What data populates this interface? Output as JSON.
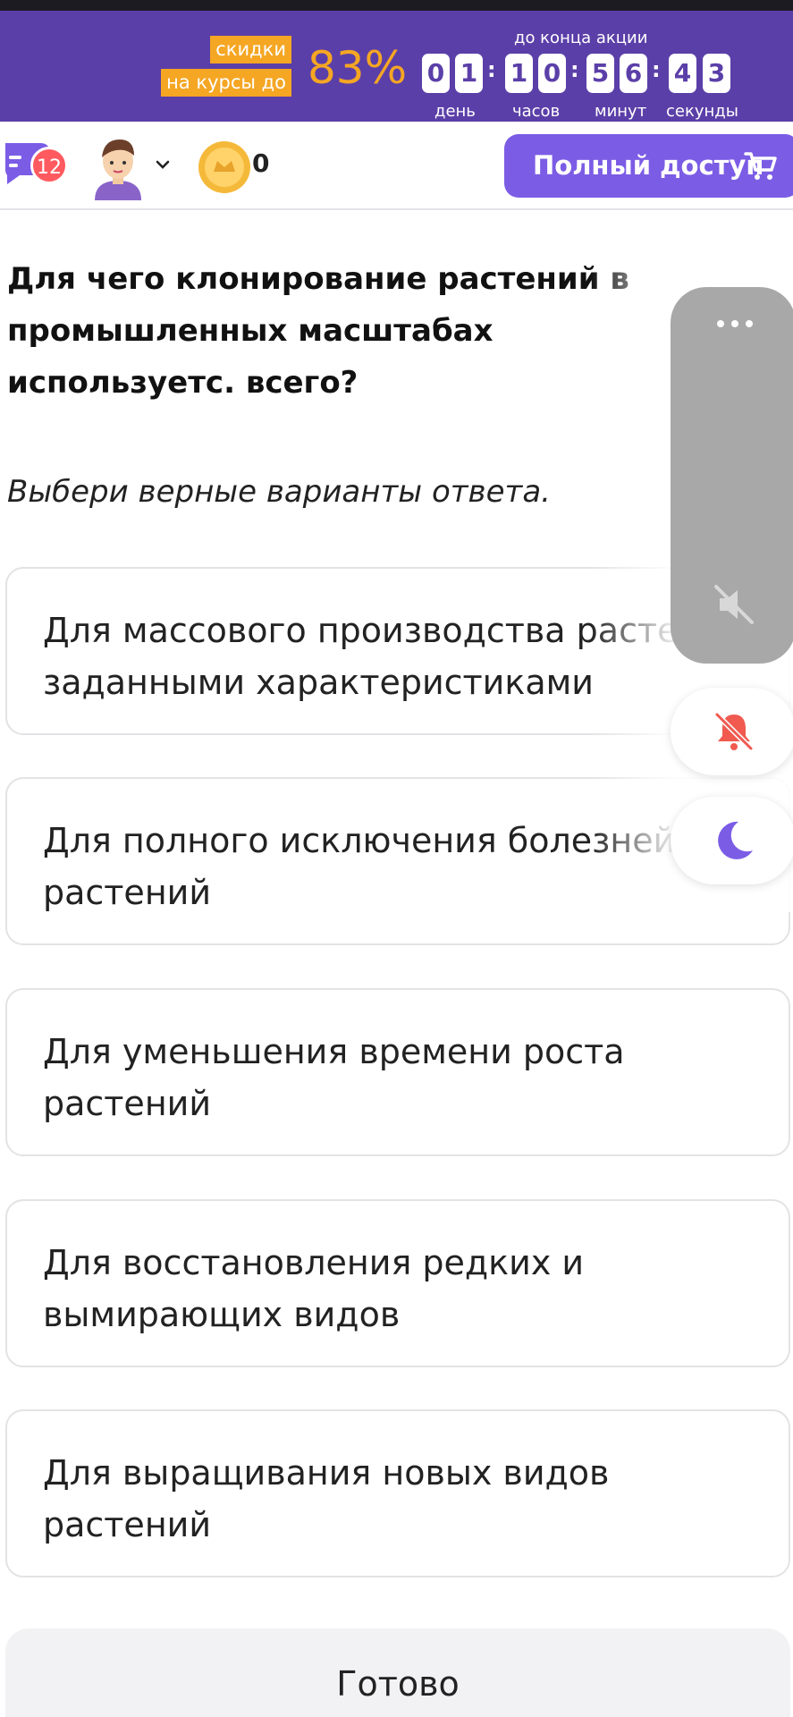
{
  "promo": {
    "tag_line1": "скидки",
    "tag_line2": "на курсы до",
    "percent": "83%",
    "countdown_title": "до конца акции",
    "digits": [
      "0",
      "1",
      "1",
      "0",
      "5",
      "6",
      "4",
      "3"
    ],
    "units": [
      "день",
      "часов",
      "минут",
      "секунды"
    ]
  },
  "header": {
    "chat_badge": "12",
    "coins": "0",
    "full_access_label": "Полный доступ"
  },
  "question": {
    "text": "Для чего клонирование растений в промышленных масштабах используетс. всего?",
    "instruction": "Выбери верные варианты ответа."
  },
  "options": [
    {
      "label": "Для массового производства растен с заданными характеристиками"
    },
    {
      "label": "Для полного исключения болезней растений"
    },
    {
      "label": "Для уменьшения времени роста растений"
    },
    {
      "label": "Для восстановления редких и вымирающих видов"
    },
    {
      "label": "Для выращивания новых видов растений"
    }
  ],
  "done_label": "Готово",
  "colors": {
    "promo_bg": "#5b3fa8",
    "accent_orange": "#f5a623",
    "button_purple": "#7b5ce5",
    "badge_red": "#ff5a5f"
  },
  "icons": [
    "chat-icon",
    "avatar-icon",
    "chevron-down-icon",
    "coin-icon",
    "cart-icon",
    "more-dots-icon",
    "mute-icon",
    "bell-off-icon",
    "moon-icon"
  ]
}
